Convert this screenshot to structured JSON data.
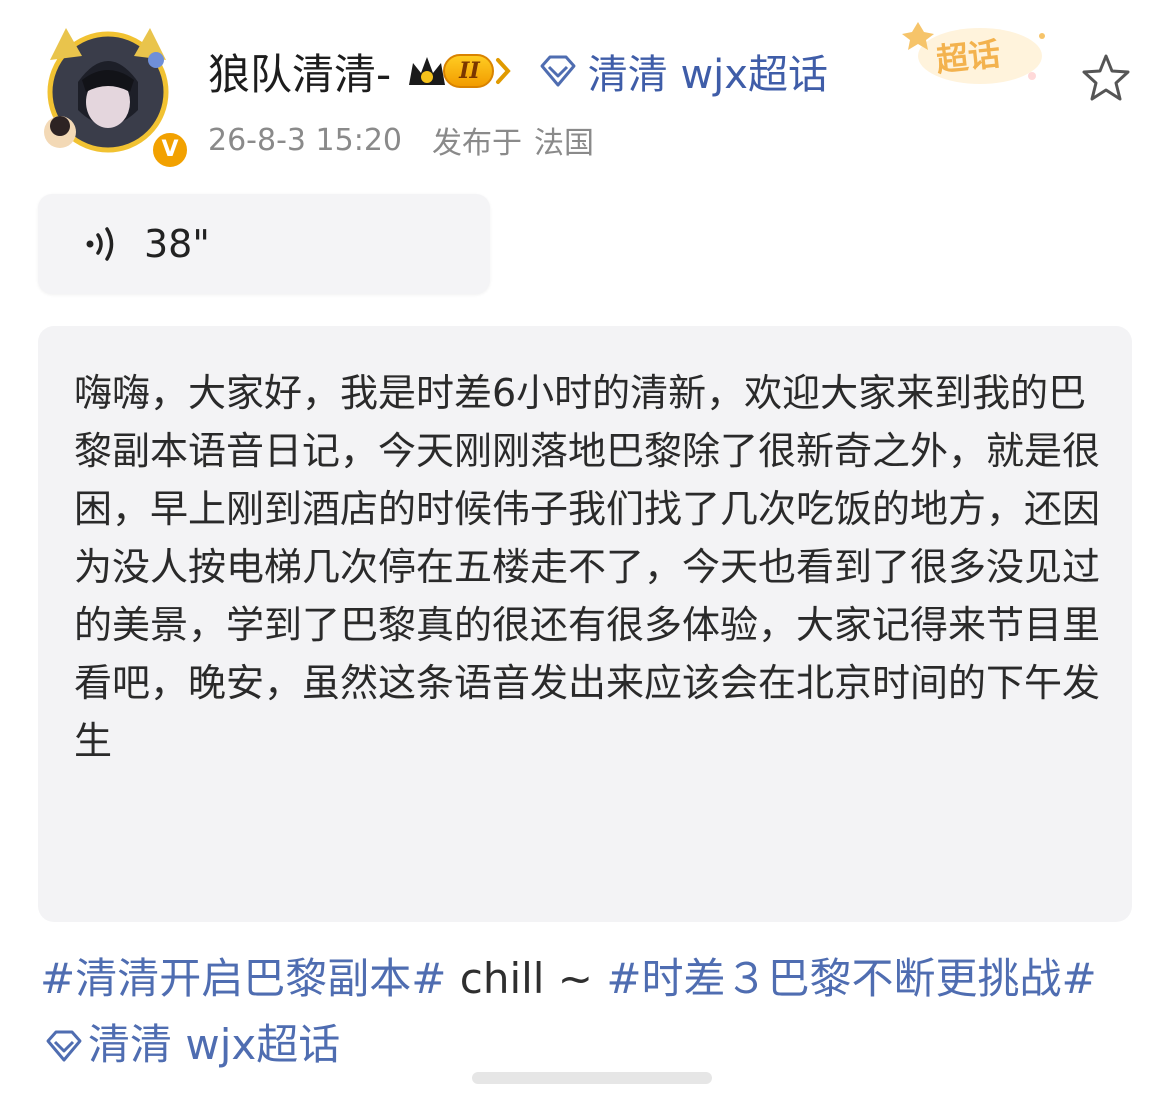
{
  "post": {
    "username": "狼队清清-",
    "level_badge": "II",
    "topic": {
      "name": "清清 wjx超话",
      "badge_label": "超话"
    },
    "timestamp": "26-8-3 15:20",
    "location_prefix": "发布于",
    "location": "法国",
    "voice": {
      "duration": "38\""
    },
    "transcript": "嗨嗨，大家好，我是时差6小时的清新，欢迎大家来到我的巴黎副本语音日记，今天刚刚落地巴黎除了很新奇之外，就是很困，早上刚到酒店的时候伟子我们找了几次吃饭的地方，还因为没人按电梯几次停在五楼走不了，今天也看到了很多没见过的美景，学到了巴黎真的很还有很多体验，大家记得来节目里看吧，晚安，虽然这条语音发出来应该会在北京时间的下午发生",
    "tags": {
      "tag1": "#清清开启巴黎副本#",
      "plain": " chill ~ ",
      "tag2": "#时差３巴黎不断更挑战#",
      "tag3": "清清 wjx超话"
    }
  },
  "colors": {
    "link": "#4f6db1",
    "verified": "#f2a100",
    "card_bg": "#f3f3f5"
  },
  "icons": [
    "verified-v-icon",
    "crown-icon",
    "diamond-topic-icon",
    "star-favorite-icon",
    "audio-wave-icon"
  ]
}
